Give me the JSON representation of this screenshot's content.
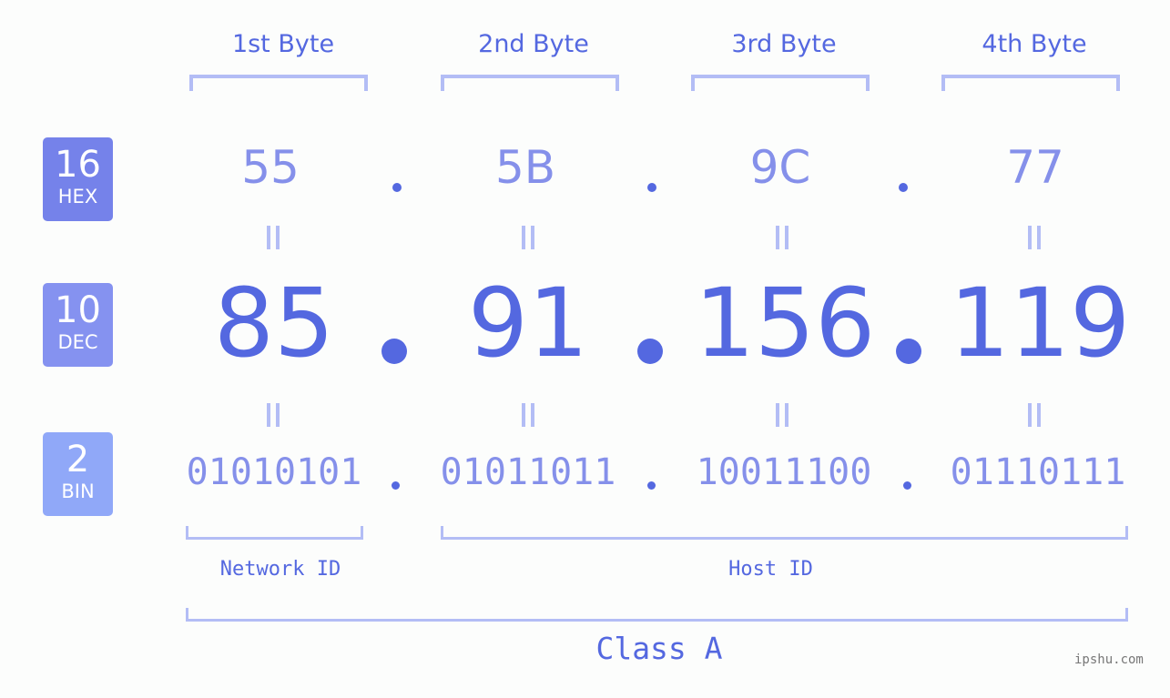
{
  "badges": [
    {
      "number": "16",
      "label": "HEX",
      "color": "#7582ea"
    },
    {
      "number": "10",
      "label": "DEC",
      "color": "#8592f0"
    },
    {
      "number": "2",
      "label": "BIN",
      "color": "#90a8f8"
    }
  ],
  "byte_labels": [
    "1st Byte",
    "2nd Byte",
    "3rd Byte",
    "4th Byte"
  ],
  "hex": [
    "55",
    "5B",
    "9C",
    "77"
  ],
  "dec": [
    "85",
    "91",
    "156",
    "119"
  ],
  "bin": [
    "01010101",
    "01011011",
    "10011100",
    "01110111"
  ],
  "separator": ".",
  "network_id_label": "Network ID",
  "host_id_label": "Host ID",
  "class_label": "Class A",
  "watermark": "ipshu.com",
  "colors": {
    "primary": "#5468e0",
    "secondary": "#8590ea",
    "bracket": "#b3bdf5"
  }
}
